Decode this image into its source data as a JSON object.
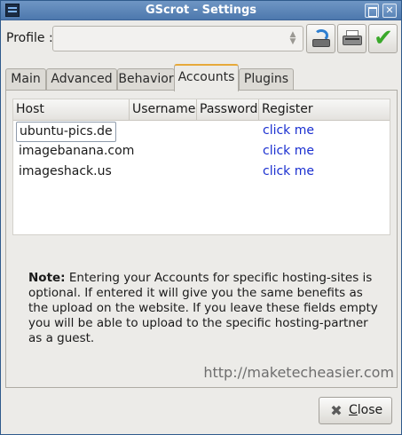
{
  "window": {
    "title": "GScrot - Settings",
    "controls": {
      "maximize": "",
      "close": "✕"
    }
  },
  "profile": {
    "label": "Profile :",
    "selected_value": "",
    "buttons": [
      "import-profile-icon",
      "printer-icon",
      "checkmark-icon"
    ]
  },
  "tabs": [
    {
      "label": "Main",
      "active": false
    },
    {
      "label": "Advanced",
      "active": false
    },
    {
      "label": "Behavior",
      "active": false
    },
    {
      "label": "Accounts",
      "active": true
    },
    {
      "label": "Plugins",
      "active": false
    }
  ],
  "accounts_table": {
    "columns": [
      "Host",
      "Username",
      "Password",
      "Register"
    ],
    "rows": [
      {
        "host": "ubuntu-pics.de",
        "username": "",
        "password": "",
        "register": "click me"
      },
      {
        "host": "imagebanana.com",
        "username": "",
        "password": "",
        "register": "click me"
      },
      {
        "host": "imageshack.us",
        "username": "",
        "password": "",
        "register": "click me"
      }
    ]
  },
  "note": {
    "prefix": "Note:",
    "text": " Entering your Accounts for specific hosting-sites is optional. If entered it will give you the same benefits as the upload on the website. If you leave these fields empty you will be able to upload to the specific hosting-partner as a guest."
  },
  "watermark": "http://maketecheasier.com",
  "footer": {
    "close_label_first": "C",
    "close_label_rest": "lose"
  },
  "colors": {
    "titlebar": "#4d78ad",
    "link": "#1a2fd0",
    "active_tab_accent": "#e6a93a",
    "confirm_green": "#3aa92a"
  }
}
